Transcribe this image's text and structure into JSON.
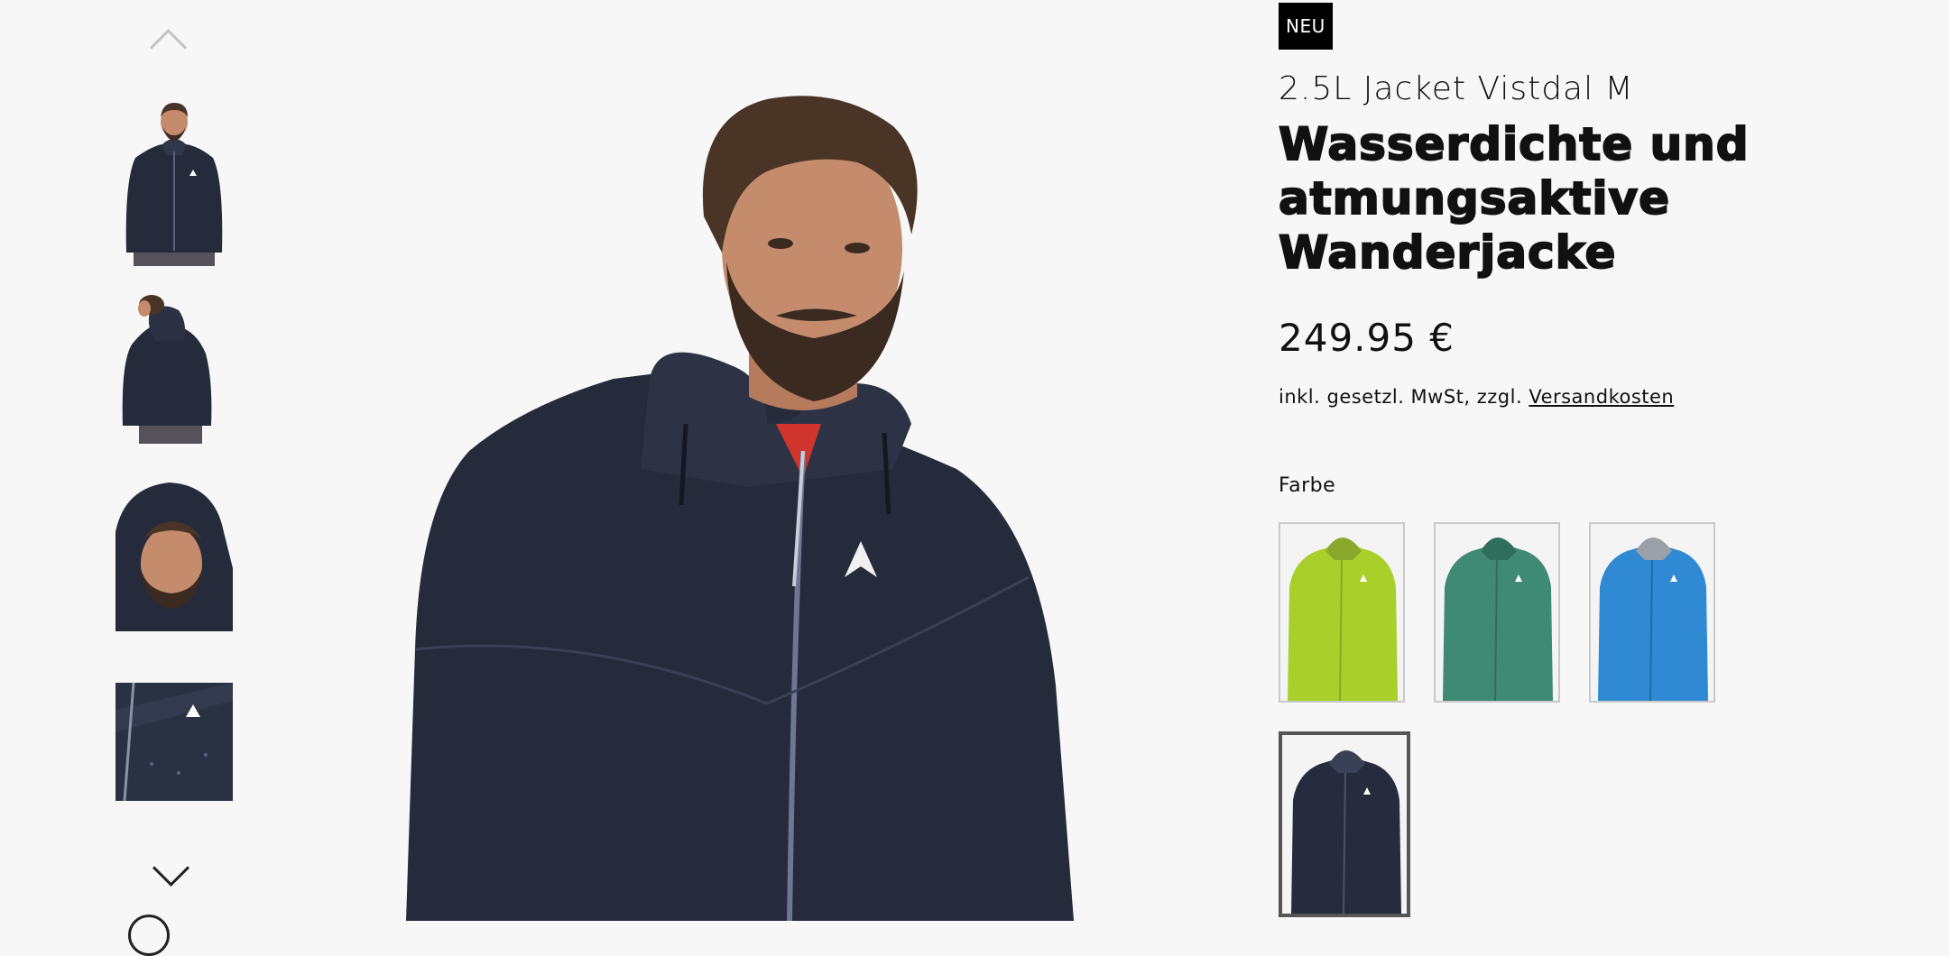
{
  "product": {
    "badge": "NEU",
    "model_name": "2.5L Jacket Vistdal M",
    "headline": "Wasserdichte und atmungsaktive Wanderjacke",
    "price": "249.95 €",
    "tax_note": "inkl. gesetzl. MwSt, zzgl.",
    "shipping_link": "Versandkosten"
  },
  "color_section": {
    "label": "Farbe",
    "swatches": [
      {
        "name": "lime",
        "color": "#a8cf2a",
        "selected": false
      },
      {
        "name": "green",
        "color": "#3f8a72",
        "selected": false
      },
      {
        "name": "blue",
        "color": "#2f8ad3",
        "selected": false
      },
      {
        "name": "navy",
        "color": "#262c3d",
        "selected": true
      }
    ]
  },
  "gallery": {
    "thumbnails": [
      "front",
      "back",
      "hood",
      "detail"
    ],
    "accent_colors": {
      "jacket": "#262b3b",
      "skin": "#c48c6c",
      "hair": "#4a3426"
    }
  }
}
